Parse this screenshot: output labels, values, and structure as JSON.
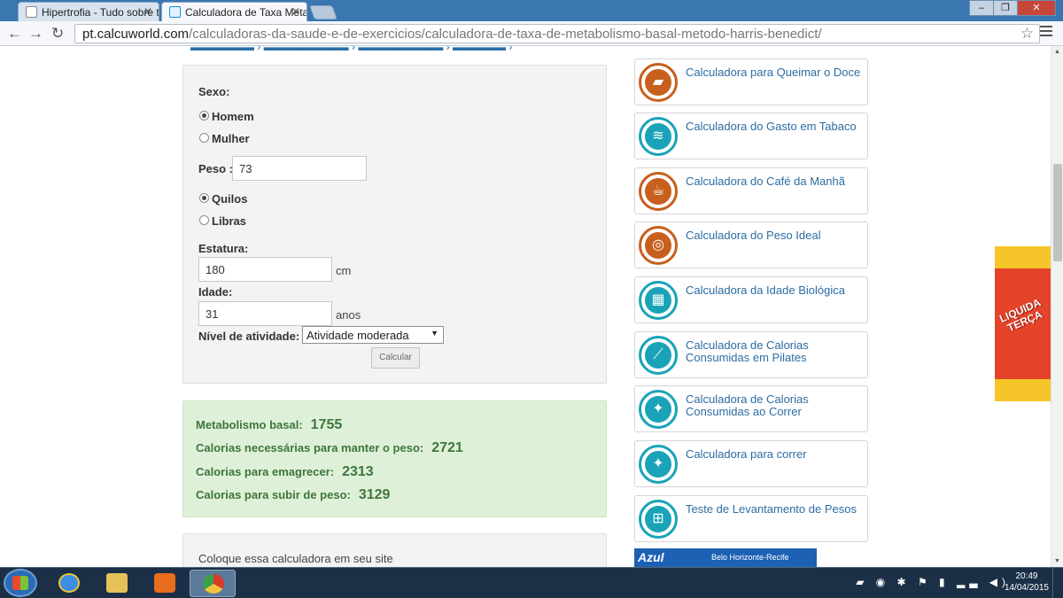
{
  "browser": {
    "tabs": [
      {
        "title": "Hipertrofia - Tudo sobre t",
        "active": false
      },
      {
        "title": "Calculadora de Taxa Meta",
        "active": true
      }
    ],
    "url_host": "pt.calcuworld.com",
    "url_path": "/calculadoras-da-saude-e-de-exercicios/calculadora-de-taxa-de-metabolismo-basal-metodo-harris-benedict/"
  },
  "form": {
    "sexo_label": "Sexo:",
    "homem_label": "Homem",
    "mulher_label": "Mulher",
    "sex_selected": "Homem",
    "peso_label": "Peso :",
    "peso_value": "73",
    "quilos_label": "Quilos",
    "libras_label": "Libras",
    "unit_selected": "Quilos",
    "estatura_label": "Estatura:",
    "estatura_value": "180",
    "estatura_unit": "cm",
    "idade_label": "Idade:",
    "idade_value": "31",
    "idade_unit": "anos",
    "atividade_label": "Nível de atividade:",
    "atividade_value": "Atividade moderada",
    "calcular_label": "Calcular"
  },
  "results": [
    {
      "label": "Metabolismo basal:",
      "value": "1755"
    },
    {
      "label": "Calorias necessárias para manter o peso:",
      "value": "2721"
    },
    {
      "label": "Calorias para emagrecer:",
      "value": "2313"
    },
    {
      "label": "Calorias para subir de peso:",
      "value": "3129"
    }
  ],
  "embed": {
    "text": "Coloque essa calculadora em seu site"
  },
  "sidebar": {
    "items": [
      {
        "label": "Calculadora para Queimar o Doce",
        "icon": "cake-icon",
        "color": "#c85f1d"
      },
      {
        "label": "Calculadora do Gasto em Tabaco",
        "icon": "cigarette-icon",
        "color": "#1aa3b8"
      },
      {
        "label": "Calculadora do Café da Manhã",
        "icon": "coffee-icon",
        "color": "#c85f1d"
      },
      {
        "label": "Calculadora do Peso Ideal",
        "icon": "scale-icon",
        "color": "#c85f1d"
      },
      {
        "label": "Calculadora da Idade Biológica",
        "icon": "calculator-icon",
        "color": "#1aa3b8"
      },
      {
        "label": "Calculadora de Calorias Consumidas em Pilates",
        "icon": "pilates-icon",
        "color": "#1aa3b8"
      },
      {
        "label": "Calculadora de Calorias Consumidas ao Correr",
        "icon": "runner-icon",
        "color": "#1aa3b8"
      },
      {
        "label": "Calculadora para correr",
        "icon": "runner-icon",
        "color": "#1aa3b8"
      },
      {
        "label": "Teste de Levantamento de Pesos",
        "icon": "weightlifting-icon",
        "color": "#1aa3b8"
      }
    ]
  },
  "ads": {
    "banner_text": "LIQUIDA TERÇA",
    "azul_brand": "Azul",
    "azul_route": "Belo Horizonte-Recife"
  },
  "taskbar": {
    "time": "20:49",
    "date": "14/04/2015"
  }
}
